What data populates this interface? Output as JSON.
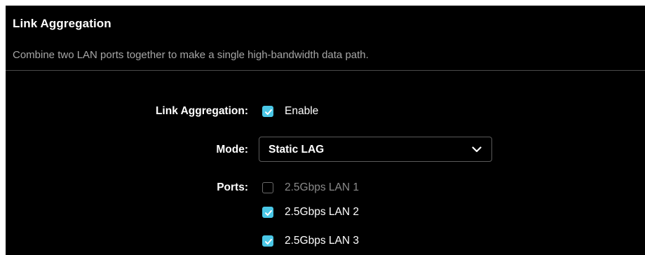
{
  "section": {
    "title": "Link Aggregation",
    "description": "Combine two LAN ports together to make a single high-bandwidth data path."
  },
  "link_aggregation": {
    "label": "Link Aggregation:",
    "enable_label": "Enable",
    "enabled": true
  },
  "mode": {
    "label": "Mode:",
    "selected": "Static LAG"
  },
  "ports": {
    "label": "Ports:",
    "items": [
      {
        "label": "2.5Gbps LAN 1",
        "checked": false,
        "disabled": true
      },
      {
        "label": "2.5Gbps LAN 2",
        "checked": true,
        "disabled": false
      },
      {
        "label": "2.5Gbps LAN 3",
        "checked": true,
        "disabled": false
      }
    ]
  },
  "colors": {
    "background": "#000000",
    "accent": "#4ac7e6",
    "muted_text": "#a6a6a6",
    "divider": "#4a4a4a"
  },
  "icons": {
    "checkbox_checked": "check-icon",
    "select_toggle": "chevron-down-icon"
  }
}
